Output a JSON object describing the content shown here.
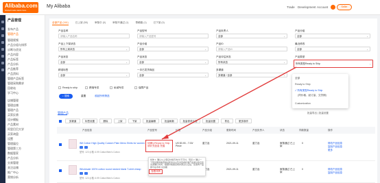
{
  "header": {
    "logo_text": "Alibaba.com",
    "logo_tag": "Global trade starts here",
    "page_title": "My Alibaba",
    "nav": [
      "Trade",
      "Development",
      "Account"
    ],
    "user_label": "Seller"
  },
  "sidebar": {
    "title": "产品管理",
    "items": [
      "发布产品",
      "管理产品",
      "管理视频",
      "产品分组与排序",
      "诊断与优化",
      "产品内容",
      "产品标签",
      "产品分析",
      "产品推荐",
      "产品资料",
      "管理产品标签",
      "管理采购需求",
      "回收站",
      "学习中心"
    ],
    "section2": [
      "店铺管理",
      "管理店铺",
      "管理产品",
      "买家反馈",
      "设计模板",
      "产品素材",
      "阿里巴巴大学",
      "买家询盘",
      "设置",
      "管理展位",
      "管理第三方",
      "数据管家",
      "产品分析",
      "交易管理",
      "关注店铺",
      "推广中心",
      "营销分析"
    ]
  },
  "tabs": [
    "全部产品 (161)",
    "已上架 (55)",
    "审核中 (0)",
    "审核不通过 (1)",
    "草稿箱 (1)",
    "已下架 (0)"
  ],
  "filters": {
    "row1_labels": [
      "产品名称",
      "产品型号",
      "产品负责人",
      "产品分组"
    ],
    "row1_values": [
      "请输入产品名称",
      "请输入产品型号",
      "全部",
      "全部"
    ],
    "row2_labels": [
      "产品上下架状态",
      "产品分组",
      "产品ID",
      "最近修改"
    ],
    "row2_values": [
      "所有上架状态",
      "全部",
      "请输入产品ID",
      "全部"
    ],
    "row3_labels": [
      "产品状态",
      "产品状态",
      "产品评估状态",
      "产品类型"
    ],
    "row3_values": [
      "全部",
      "全部",
      "所有状态",
      "所有类型Ready to Ship"
    ],
    "row4_labels": [
      "精准标签",
      "一手已发货商品",
      "多渠道"
    ],
    "row4_values": [
      "全部",
      "全部",
      "多渠道 / 全部"
    ],
    "checks": [
      "Ready to ship",
      "跨境专供",
      "私域专供",
      "保障产品"
    ],
    "search_btn": "搜索",
    "reset_btn": "重置",
    "more_link": "收起所有筛选"
  },
  "dropdown": {
    "options": [
      "全部",
      "Ready to Ship",
      "所有类型Ready to Ship",
      "(同价格、起订量、交货期)",
      "Customization"
    ],
    "selected_index": 2
  },
  "list": {
    "title": "管理产品",
    "right_links": [
      "批量导出",
      "批量设置"
    ],
    "toolbar": [
      "全选",
      "多渠道",
      "标签设置",
      "删除",
      "上架",
      "下架",
      "批量编辑",
      "批量刷新",
      "批量修改价格",
      "批量设置",
      "导出",
      "更多操作"
    ],
    "columns": [
      "产品信息",
      "产品型号",
      "价格",
      "产品分组",
      "更新时间",
      "产品负责人",
      "状态",
      "同款数量",
      "操作"
    ]
  },
  "rows": [
    {
      "name": "Wit Cotton High Quality Custom Plain Mens Shirts for women",
      "meta": "型号: 123  价格: 6.99 Cotton/Men's Cotton",
      "model": "待确认",
      "price": "US $3.93 - 7.00/ Piece",
      "price_note": "(同价格/起订量)",
      "group": "重力及",
      "updated": "2021-09-11",
      "owner": "重力及",
      "status": "审核通过 已上架",
      "count": "0",
      "actions": [
        "修改产品信息",
        "复制产品信息",
        "更多"
      ],
      "model_note": "待确认Ready to Ship 请补充信息 完善"
    },
    {
      "name": "Wholesale 100% cotton round necked blank T-shirt cheap",
      "meta": "型号: 123  价格: 6.99 Cotton/Men's Cotton",
      "price": "US $3.93 - 7.00/ Piece",
      "group": "重力及",
      "updated": "2021-09-11",
      "owner": "重力及",
      "status": "审核通过 已上架",
      "count": "0",
      "actions": [
        "修改产品信息",
        "复制产品信息"
      ]
    }
  ],
  "popup": {
    "text": "将你 1. 确认以上保证价格可支付/不可付，现货 2. 确认一下现货服务物流地址和支付以及对完成标准产品通过会与您交通确认时间，根据价格需完成并通过认证后，您发布产品即可在市场 交货期",
    "link": "查看详情"
  },
  "colors": {
    "accent": "#ff6a00",
    "blue": "#1a5df0",
    "highlight_red": "#e13b3b"
  }
}
